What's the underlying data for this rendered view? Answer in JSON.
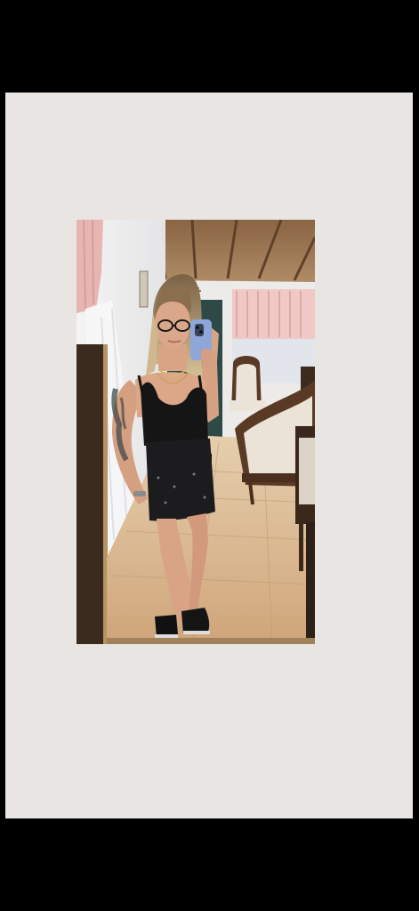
{
  "viewer": {
    "background_color": "#000000",
    "card_color": "#e8e5e3"
  },
  "photo": {
    "icon": "photo-image",
    "subject": "mirror-selfie"
  },
  "colors": {
    "ceiling_wood": "#9b7550",
    "wall": "#ecebea",
    "curtain_pink": "#e8b8b4",
    "floor_tile": "#d8b890",
    "door": "#2b4a48",
    "outfit": "#151515",
    "skin": "#d9a485",
    "phone": "#8fa6d8",
    "chair_wood": "#5a3a26",
    "chair_fabric": "#e9e1d6"
  }
}
